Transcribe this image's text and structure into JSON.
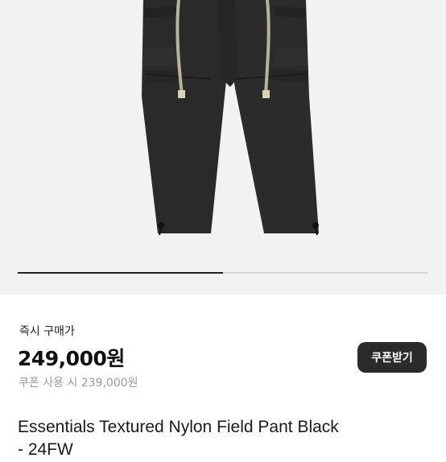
{
  "product": {
    "image_icon": "cargo-pants-photo",
    "carousel": {
      "current": 1,
      "total": 2,
      "progress": 0.5
    },
    "purchase_label": "즉시 구매가",
    "price": "249,000원",
    "coupon_price_text": "쿠폰 사용 시 239,000원",
    "coupon_button_label": "쿠폰받기",
    "title_line1": "Essentials Textured Nylon Field Pant Black",
    "title_line2": "- 24FW"
  },
  "colors": {
    "background": "#ffffff",
    "image_bg": "#f2f2f2",
    "pants": "#2a2a2a",
    "drawcord": "#b8b596",
    "button_bg": "#2b2b2b",
    "muted_text": "#9a9a9a"
  }
}
